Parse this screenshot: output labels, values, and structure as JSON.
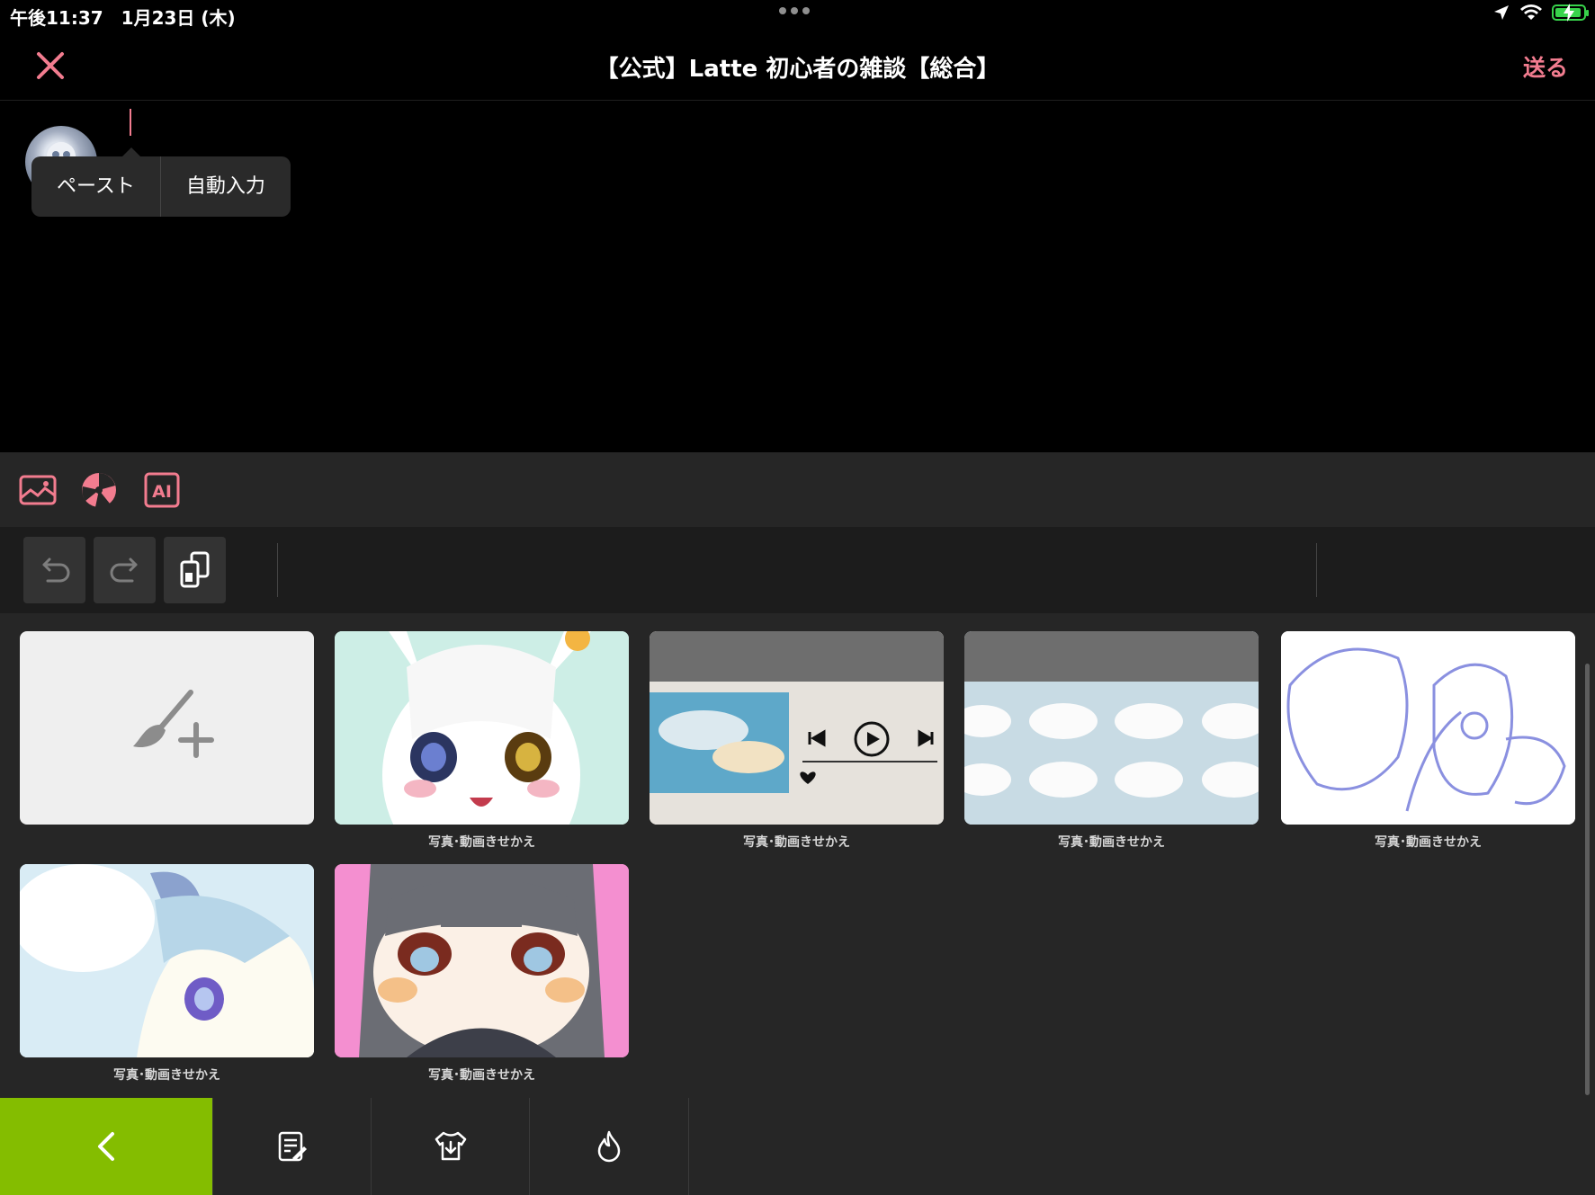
{
  "status_bar": {
    "time": "午後11:37　1月23日 (木)"
  },
  "header": {
    "title": "【公式】Latte 初心者の雑談【総合】",
    "send_label": "送る"
  },
  "edit_menu": {
    "paste": "ペースト",
    "autofill": "自動入力"
  },
  "tools": [
    "image-icon",
    "palette-icon",
    "ai-icon"
  ],
  "tool_ai_label": "AI",
  "theme_grid": {
    "item_label": "写真･動画きせかえ",
    "items": [
      {
        "label": "写真･動画きせかえ"
      },
      {
        "label": "写真･動画きせかえ"
      },
      {
        "label": "写真･動画きせかえ"
      },
      {
        "label": "写真･動画きせかえ"
      },
      {
        "label": "写真･動画きせかえ"
      },
      {
        "label": "写真･動画きせかえ"
      }
    ]
  },
  "colors": {
    "accent": "#f27c8f",
    "back_button": "#84bd00"
  }
}
